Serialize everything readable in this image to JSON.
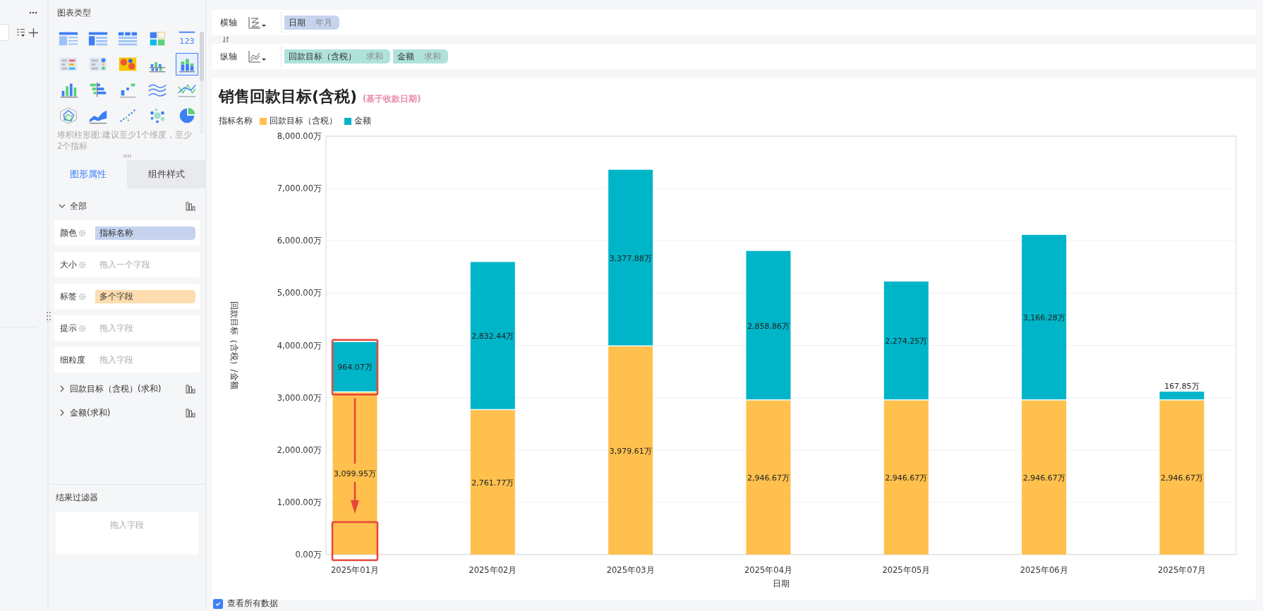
{
  "chart_type_panel": {
    "title": "图表类型",
    "types": [
      {
        "selected": false
      },
      {
        "selected": false
      },
      {
        "selected": false
      },
      {
        "selected": false
      },
      {
        "selected": false,
        "label": "123"
      },
      {
        "selected": false
      },
      {
        "selected": false
      },
      {
        "selected": false
      },
      {
        "selected": false
      },
      {
        "selected": true
      },
      {
        "selected": false
      },
      {
        "selected": false
      },
      {
        "selected": false
      },
      {
        "selected": false
      },
      {
        "selected": false
      },
      {
        "selected": false
      },
      {
        "selected": false
      },
      {
        "selected": false
      },
      {
        "selected": false
      },
      {
        "selected": false
      }
    ],
    "hint": "堆积柱形图:建议至少1个维度，至少2个指标"
  },
  "property_tabs": [
    {
      "label": "图形属性",
      "selected": true
    },
    {
      "label": "组件样式",
      "selected": false
    }
  ],
  "sections": [
    {
      "label": "全部",
      "expanded": true,
      "fields": [
        {
          "label": "颜色",
          "settings": true,
          "value": "指标名称",
          "color": "#c5d3ee"
        },
        {
          "label": "大小",
          "settings": true,
          "placeholder": "拖入一个字段"
        },
        {
          "label": "标签",
          "settings": true,
          "value": "多个字段",
          "color": "#fddcb0"
        },
        {
          "label": "提示",
          "settings": true,
          "placeholder": "拖入字段"
        },
        {
          "label": "细粒度",
          "settings": false,
          "placeholder": "拖入字段"
        }
      ]
    },
    {
      "label": "回款目标（含税）(求和)",
      "expanded": false
    },
    {
      "label": "金额(求和)",
      "expanded": false
    }
  ],
  "result_filter": {
    "title": "结果过滤器",
    "placeholder": "拖入字段"
  },
  "axes": [
    {
      "label": "横轴",
      "pills": [
        {
          "name": "日期",
          "agg": "年月",
          "color": "#c6d3ee"
        }
      ]
    },
    {
      "label": "纵轴",
      "pills": [
        {
          "name": "回款目标（含税）",
          "agg": "求和",
          "color": "#b0e2dc"
        },
        {
          "name": "金额",
          "agg": "求和",
          "color": "#b0e2dc"
        }
      ]
    }
  ],
  "chart": {
    "title": "销售回款目标(含税)",
    "subtitle": "(基于收款日期)",
    "legend_title": "指标名称",
    "chart_data": {
      "type": "bar",
      "stacked": true,
      "grid": true,
      "xlabel": "日期",
      "ylabel": "回款目标（含税）/金额",
      "categories": [
        "2025年01月",
        "2025年02月",
        "2025年03月",
        "2025年04月",
        "2025年05月",
        "2025年06月",
        "2025年07月"
      ],
      "series": [
        {
          "name": "回款目标（含税）",
          "color": "#ffc04d",
          "values": [
            3099.95,
            2761.77,
            3979.61,
            2946.67,
            2946.67,
            2946.67,
            2946.67
          ]
        },
        {
          "name": "金额",
          "color": "#00b5c8",
          "values": [
            964.07,
            2832.44,
            3377.88,
            2858.86,
            2274.25,
            3166.28,
            167.85
          ]
        }
      ],
      "value_labels": [
        [
          "3,099.95万",
          "2,761.77万",
          "3,979.61万",
          "2,946.67万",
          "2,946.67万",
          "2,946.67万",
          "2,946.67万"
        ],
        [
          "964.07万",
          "2,832.44万",
          "3,377.88万",
          "2,858.86万",
          "2,274.25万",
          "3,166.28万",
          "167.85万"
        ]
      ],
      "ylim": [
        0,
        8000
      ],
      "yticks": [
        {
          "value": 0,
          "label": "0.00万"
        },
        {
          "value": 1000,
          "label": "1,000.00万"
        },
        {
          "value": 2000,
          "label": "2,000.00万"
        },
        {
          "value": 3000,
          "label": "3,000.00万"
        },
        {
          "value": 4000,
          "label": "4,000.00万"
        },
        {
          "value": 5000,
          "label": "5,000.00万"
        },
        {
          "value": 6000,
          "label": "6,000.00万"
        },
        {
          "value": 7000,
          "label": "7,000.00万"
        },
        {
          "value": 8000,
          "label": "8,000.00万"
        }
      ]
    }
  },
  "show_all_data": {
    "label": "查看所有数据",
    "checked": true
  }
}
